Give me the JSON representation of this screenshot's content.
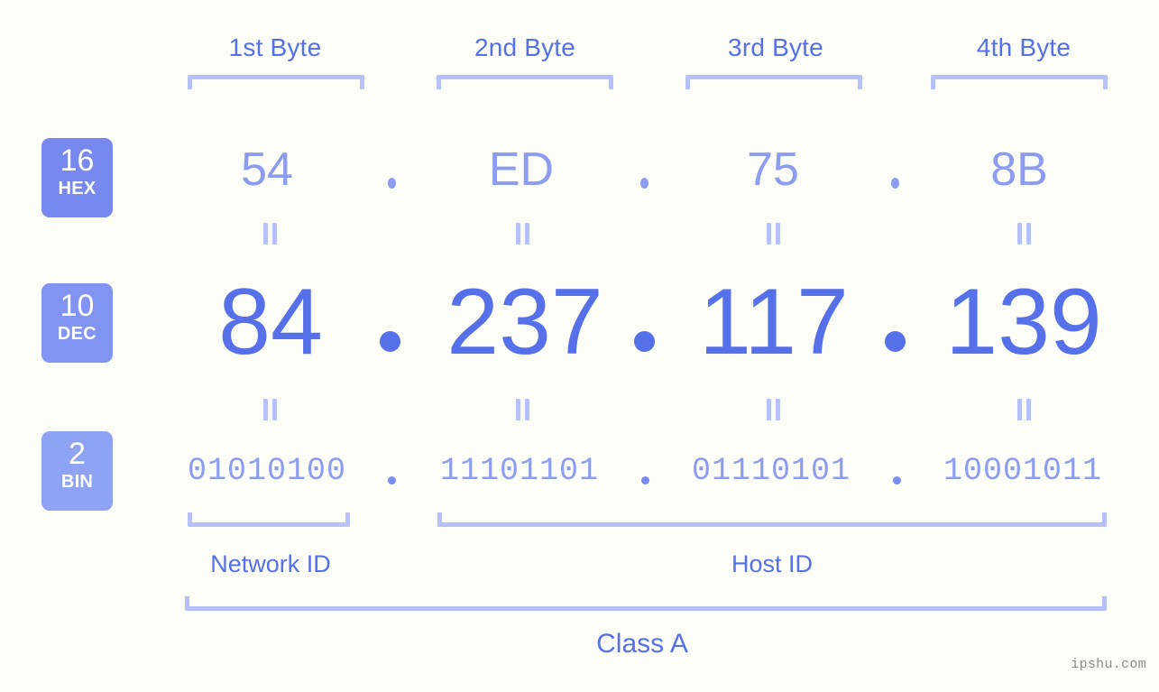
{
  "meta": {
    "background_color": "#fcfdf7",
    "accent_color": "#5570e8",
    "light_accent_color": "#b6c1fb",
    "muted_accent_color": "#8c9cf0"
  },
  "byte_headers": [
    {
      "label": "1st Byte"
    },
    {
      "label": "2nd Byte"
    },
    {
      "label": "3rd Byte"
    },
    {
      "label": "4th Byte"
    }
  ],
  "bases": [
    {
      "number": "16",
      "abbr": "HEX",
      "color": "#7788ee"
    },
    {
      "number": "10",
      "abbr": "DEC",
      "color": "#8294f2"
    },
    {
      "number": "2",
      "abbr": "BIN",
      "color": "#8fa3f5"
    }
  ],
  "rows": {
    "hex": {
      "values": [
        "54",
        "ED",
        "75",
        "8B"
      ],
      "separator": "."
    },
    "dec": {
      "values": [
        "84",
        "237",
        "117",
        "139"
      ],
      "separator": "."
    },
    "bin": {
      "values": [
        "01010100",
        "11101101",
        "01110101",
        "10001011"
      ],
      "separator": "."
    }
  },
  "equals_symbol": "=",
  "segments": {
    "network_id": {
      "label": "Network ID"
    },
    "host_id": {
      "label": "Host ID"
    },
    "class": {
      "label": "Class A"
    }
  },
  "watermark": {
    "text": "ipshu.com"
  }
}
